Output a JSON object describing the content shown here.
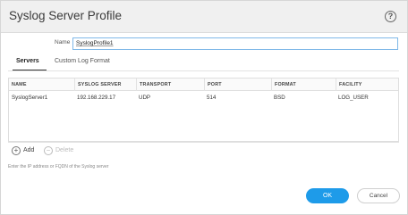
{
  "dialog": {
    "title": "Syslog Server Profile",
    "help_icon": "help-icon",
    "help_glyph": "?"
  },
  "name_field": {
    "label": "Name",
    "value": "SyslogProfile1"
  },
  "tabs": [
    {
      "label": "Servers",
      "active": true
    },
    {
      "label": "Custom Log Format",
      "active": false
    }
  ],
  "grid": {
    "columns": [
      "NAME",
      "SYSLOG SERVER",
      "TRANSPORT",
      "PORT",
      "FORMAT",
      "FACILITY"
    ],
    "rows": [
      {
        "name": "SyslogServer1",
        "server": "192.168.229.17",
        "transport": "UDP",
        "port": "514",
        "format": "BSD",
        "facility": "LOG_USER"
      }
    ]
  },
  "toolbar": {
    "add_label": "Add",
    "add_glyph": "+",
    "delete_label": "Delete",
    "delete_glyph": "−"
  },
  "hint": "Enter the IP address or FQDN of the Syslog server",
  "buttons": {
    "ok": "OK",
    "cancel": "Cancel"
  },
  "colors": {
    "accent": "#1e9be9",
    "input_border": "#7fb8e8"
  }
}
